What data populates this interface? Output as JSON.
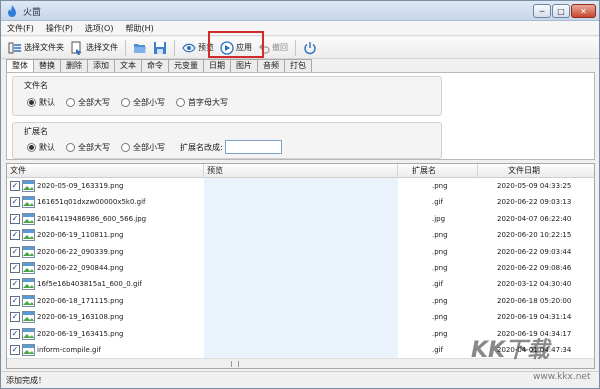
{
  "window": {
    "title": "火茴",
    "min_label": "─",
    "max_label": "□",
    "close_label": "✕"
  },
  "menu": [
    "文件(F)",
    "操作(P)",
    "选项(O)",
    "帮助(H)"
  ],
  "toolbar": {
    "select_folder": "选择文件夹",
    "select_file": "选择文件",
    "preview": "预览",
    "apply": "应用",
    "undo": "撤回"
  },
  "tabs": [
    "整体",
    "替换",
    "删除",
    "添加",
    "文本",
    "命令",
    "元变量",
    "日期",
    "图片",
    "音频",
    "打包"
  ],
  "filename_group": {
    "title": "文件名",
    "options": [
      "默认",
      "全部大写",
      "全部小写",
      "首字母大写"
    ],
    "selected": 0
  },
  "extension_group": {
    "title": "扩展名",
    "options": [
      "默认",
      "全部大写",
      "全部小写"
    ],
    "selected": 0,
    "change_label": "扩展名改成:",
    "change_value": ""
  },
  "columns": [
    "文件",
    "预览",
    "扩展名",
    "文件日期"
  ],
  "rows": [
    {
      "name": "2020-05-09_163319.png",
      "ext": ".png",
      "date": "2020-05-09 04:33:25"
    },
    {
      "name": "161651q01dxzw00000x5k0.gif",
      "ext": ".gif",
      "date": "2020-06-22 09:03:13"
    },
    {
      "name": "20164119486986_600_566.jpg",
      "ext": ".jpg",
      "date": "2020-04-07 06:22:40"
    },
    {
      "name": "2020-06-19_110811.png",
      "ext": ".png",
      "date": "2020-06-20 10:22:15"
    },
    {
      "name": "2020-06-22_090339.png",
      "ext": ".png",
      "date": "2020-06-22 09:03:44"
    },
    {
      "name": "2020-06-22_090844.png",
      "ext": ".png",
      "date": "2020-06-22 09:08:46"
    },
    {
      "name": "16f5e16b403815a1_600_0.gif",
      "ext": ".gif",
      "date": "2020-03-12 04:30:40"
    },
    {
      "name": "2020-06-18_171115.png",
      "ext": ".png",
      "date": "2020-06-18 05:20:00"
    },
    {
      "name": "2020-06-19_163108.png",
      "ext": ".png",
      "date": "2020-06-19 04:31:14"
    },
    {
      "name": "2020-06-19_163415.png",
      "ext": ".png",
      "date": "2020-06-19 04:34:17"
    },
    {
      "name": "inform-compile.gif",
      "ext": ".gif",
      "date": "2020-04-01 04:47:34"
    }
  ],
  "status": "添加完成！",
  "watermark": "KK下载",
  "watermark_url": "www.kkx.net",
  "colors": {
    "highlight": "#d22b2b",
    "preview_bg": "#eaf2fc"
  }
}
